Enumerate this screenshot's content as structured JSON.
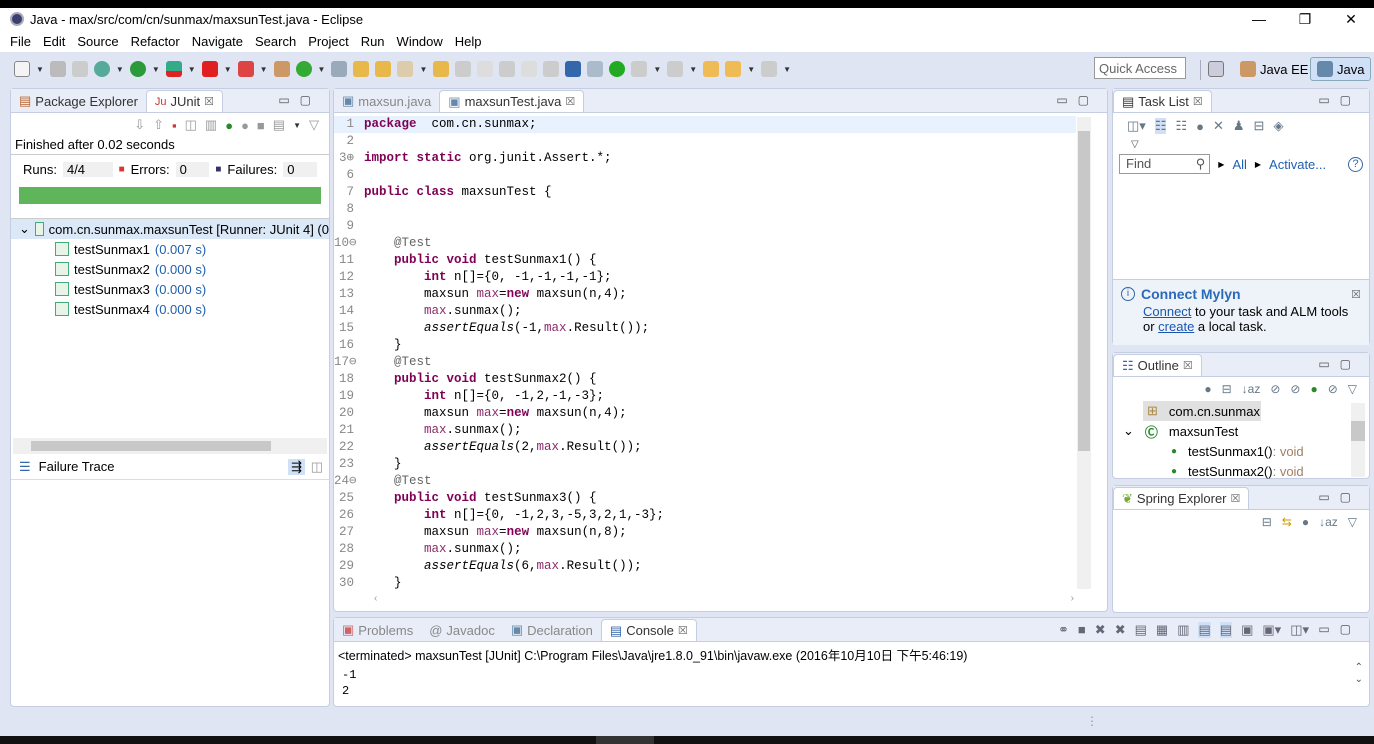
{
  "window": {
    "title": "Java - max/src/com/cn/sunmax/maxsunTest.java - Eclipse",
    "minimize": "—",
    "maximize": "❐",
    "close": "✕"
  },
  "menu": [
    "File",
    "Edit",
    "Source",
    "Refactor",
    "Navigate",
    "Search",
    "Project",
    "Run",
    "Window",
    "Help"
  ],
  "toolbar": {
    "quick_access": "Quick Access",
    "perspectives": [
      "Java EE",
      "Java"
    ]
  },
  "left": {
    "tabs": [
      "Package Explorer",
      "JUnit"
    ],
    "status": "Finished after 0.02 seconds",
    "runs_label": "Runs:",
    "runs": "4/4",
    "errors_label": "Errors:",
    "errors": "0",
    "failures_label": "Failures:",
    "failures": "0",
    "progress": 1.0,
    "progress_color": "#5fb65a",
    "suite": "com.cn.sunmax.maxsunTest [Runner: JUnit 4] (0",
    "tests": [
      {
        "name": "testSunmax1",
        "time": "(0.007 s)"
      },
      {
        "name": "testSunmax2",
        "time": "(0.000 s)"
      },
      {
        "name": "testSunmax3",
        "time": "(0.000 s)"
      },
      {
        "name": "testSunmax4",
        "time": "(0.000 s)"
      }
    ],
    "failure_trace": "Failure Trace"
  },
  "editor": {
    "tabs": [
      "maxsun.java",
      "maxsunTest.java"
    ],
    "lines": [
      {
        "n": "1",
        "t": [
          [
            "kw",
            "package"
          ],
          [
            "",
            "  com.cn.sunmax;"
          ]
        ]
      },
      {
        "n": "2",
        "t": []
      },
      {
        "n": "3⊕",
        "t": [
          [
            "kw",
            "import static"
          ],
          [
            "",
            " org.junit.Assert.*;"
          ]
        ]
      },
      {
        "n": "6",
        "t": []
      },
      {
        "n": "7",
        "t": [
          [
            "kw",
            "public class"
          ],
          [
            "",
            " maxsunTest {"
          ]
        ]
      },
      {
        "n": "8",
        "t": []
      },
      {
        "n": "9",
        "t": []
      },
      {
        "n": "10⊖",
        "t": [
          [
            "an",
            "    @Test"
          ]
        ]
      },
      {
        "n": "11",
        "t": [
          [
            "kw",
            "    public void"
          ],
          [
            "",
            " testSunmax1() {"
          ]
        ]
      },
      {
        "n": "12",
        "t": [
          [
            "kw",
            "        int"
          ],
          [
            "",
            " n[]={0, -1,-1,-1,-1};"
          ]
        ]
      },
      {
        "n": "13",
        "t": [
          [
            "",
            "        maxsun "
          ],
          [
            "vr",
            "max"
          ],
          [
            "",
            "="
          ],
          [
            "kw",
            "new"
          ],
          [
            "",
            " maxsun(n,4);"
          ]
        ]
      },
      {
        "n": "14",
        "t": [
          [
            "vr",
            "        max"
          ],
          [
            "",
            ".sunmax();"
          ]
        ]
      },
      {
        "n": "15",
        "t": [
          [
            "it",
            "        assertEquals"
          ],
          [
            "",
            "(-1,"
          ],
          [
            "vr",
            "max"
          ],
          [
            "",
            ".Result());"
          ]
        ]
      },
      {
        "n": "16",
        "t": [
          [
            "",
            "    }"
          ]
        ]
      },
      {
        "n": "17⊖",
        "t": [
          [
            "an",
            "    @Test"
          ]
        ]
      },
      {
        "n": "18",
        "t": [
          [
            "kw",
            "    public void"
          ],
          [
            "",
            " testSunmax2() {"
          ]
        ]
      },
      {
        "n": "19",
        "t": [
          [
            "kw",
            "        int"
          ],
          [
            "",
            " n[]={0, -1,2,-1,-3};"
          ]
        ]
      },
      {
        "n": "20",
        "t": [
          [
            "",
            "        maxsun "
          ],
          [
            "vr",
            "max"
          ],
          [
            "",
            "="
          ],
          [
            "kw",
            "new"
          ],
          [
            "",
            " maxsun(n,4);"
          ]
        ]
      },
      {
        "n": "21",
        "t": [
          [
            "vr",
            "        max"
          ],
          [
            "",
            ".sunmax();"
          ]
        ]
      },
      {
        "n": "22",
        "t": [
          [
            "it",
            "        assertEquals"
          ],
          [
            "",
            "(2,"
          ],
          [
            "vr",
            "max"
          ],
          [
            "",
            ".Result());"
          ]
        ]
      },
      {
        "n": "23",
        "t": [
          [
            "",
            "    }"
          ]
        ]
      },
      {
        "n": "24⊖",
        "t": [
          [
            "an",
            "    @Test"
          ]
        ]
      },
      {
        "n": "25",
        "t": [
          [
            "kw",
            "    public void"
          ],
          [
            "",
            " testSunmax3() {"
          ]
        ]
      },
      {
        "n": "26",
        "t": [
          [
            "kw",
            "        int"
          ],
          [
            "",
            " n[]={0, -1,2,3,-5,3,2,1,-3};"
          ]
        ]
      },
      {
        "n": "27",
        "t": [
          [
            "",
            "        maxsun "
          ],
          [
            "vr",
            "max"
          ],
          [
            "",
            "="
          ],
          [
            "kw",
            "new"
          ],
          [
            "",
            " maxsun(n,8);"
          ]
        ]
      },
      {
        "n": "28",
        "t": [
          [
            "vr",
            "        max"
          ],
          [
            "",
            ".sunmax();"
          ]
        ]
      },
      {
        "n": "29",
        "t": [
          [
            "it",
            "        assertEquals"
          ],
          [
            "",
            "(6,"
          ],
          [
            "vr",
            "max"
          ],
          [
            "",
            ".Result());"
          ]
        ]
      },
      {
        "n": "30",
        "t": [
          [
            "",
            "    }"
          ]
        ]
      }
    ]
  },
  "tasklist": {
    "tab": "Task List",
    "find": "Find",
    "all": "All",
    "activate": "Activate...",
    "help": "?"
  },
  "mylyn": {
    "title": "Connect Mylyn",
    "connect": "Connect",
    "text1": " to your task and ALM tools",
    "or": "or ",
    "create": "create",
    "text2": " a local task."
  },
  "outline": {
    "tab": "Outline",
    "package": "com.cn.sunmax",
    "class": "maxsunTest",
    "methods": [
      {
        "name": "testSunmax1()",
        "type": " : void"
      },
      {
        "name": "testSunmax2()",
        "type": " : void"
      }
    ]
  },
  "spring": {
    "tab": "Spring Explorer"
  },
  "console": {
    "tabs": [
      "Problems",
      "Javadoc",
      "Declaration",
      "Console"
    ],
    "header": "<terminated> maxsunTest [JUnit] C:\\Program Files\\Java\\jre1.8.0_91\\bin\\javaw.exe (2016年10月10日 下午5:46:19)",
    "output": [
      "-1",
      "2"
    ]
  }
}
